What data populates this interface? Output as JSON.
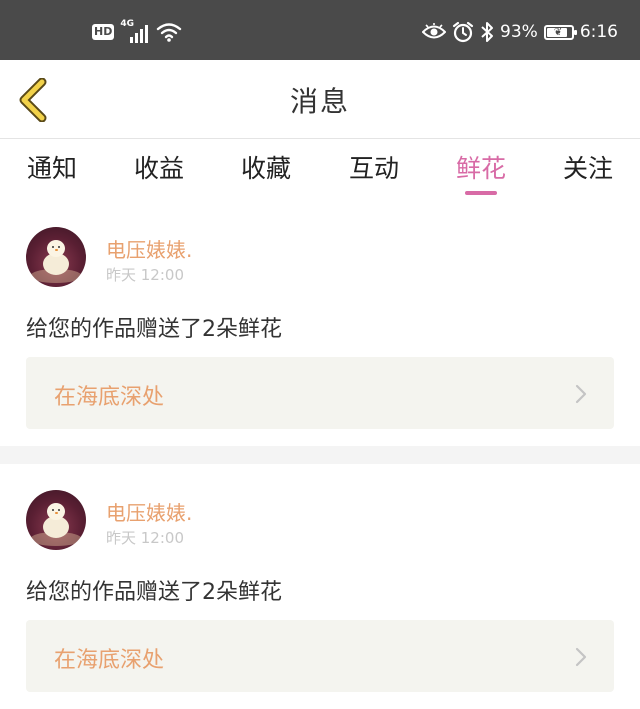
{
  "status_bar": {
    "hd_label": "HD",
    "network_label": "4G",
    "battery_percent_text": "93%",
    "battery_level": 0.93,
    "time": "6:16"
  },
  "header": {
    "title": "消息"
  },
  "tabs": [
    {
      "label": "通知",
      "active": false
    },
    {
      "label": "收益",
      "active": false
    },
    {
      "label": "收藏",
      "active": false
    },
    {
      "label": "互动",
      "active": false
    },
    {
      "label": "鲜花",
      "active": true
    },
    {
      "label": "关注",
      "active": false
    }
  ],
  "notifications": [
    {
      "username": "电压婊婊.",
      "time": "昨天 12:00",
      "message": "给您的作品赠送了2朵鲜花",
      "work_title": "在海底深处"
    },
    {
      "username": "电压婊婊.",
      "time": "昨天 12:00",
      "message": "给您的作品赠送了2朵鲜花",
      "work_title": "在海底深处"
    }
  ],
  "colors": {
    "status_bar_bg": "#4a4a4a",
    "accent_pink": "#d86ba6",
    "accent_orange": "#e8a16f",
    "back_arrow_yellow": "#f2d24a",
    "card_link_bg": "#f4f4ef"
  }
}
